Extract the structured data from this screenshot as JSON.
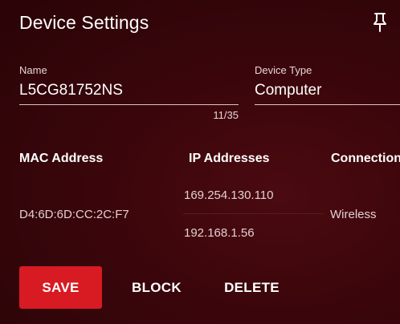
{
  "header": {
    "title": "Device Settings",
    "pin_icon": "pin-icon"
  },
  "form": {
    "name": {
      "label": "Name",
      "value": "L5CG81752NS",
      "counter": "11/35"
    },
    "device_type": {
      "label": "Device Type",
      "value": "Computer"
    }
  },
  "details": {
    "headers": {
      "mac": "MAC Address",
      "ip": "IP Addresses",
      "connection": "Connection"
    },
    "mac": "D4:6D:6D:CC:2C:F7",
    "ips": [
      "169.254.130.110",
      "192.168.1.56"
    ],
    "connection": "Wireless"
  },
  "actions": {
    "save": "SAVE",
    "block": "BLOCK",
    "delete": "DELETE"
  },
  "colors": {
    "background": "#3a060b",
    "accent": "#d81a23"
  }
}
